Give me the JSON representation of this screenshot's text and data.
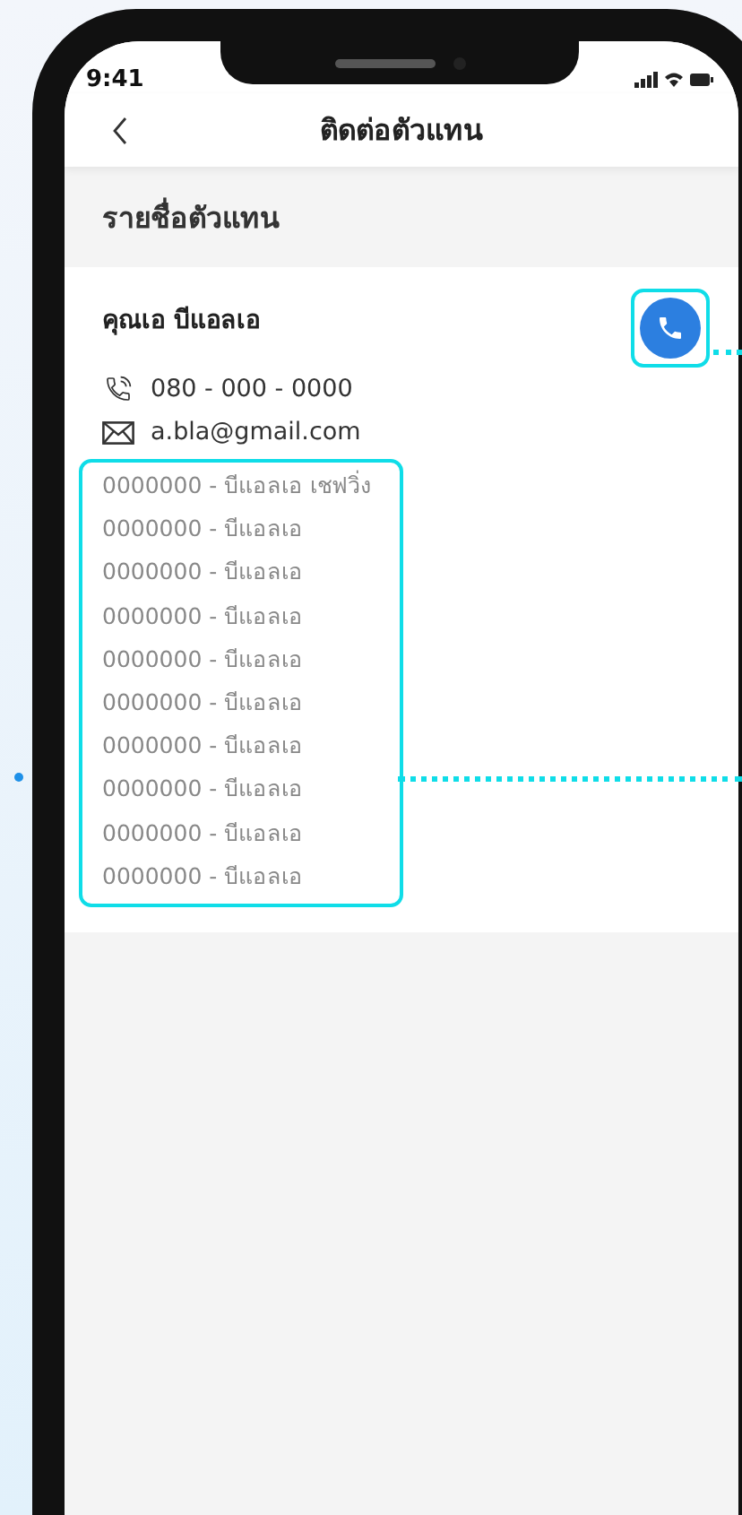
{
  "status_bar": {
    "time": "9:41"
  },
  "header": {
    "title": "ติดต่อตัวแทน"
  },
  "section": {
    "title": "รายชื่อตัวแทน"
  },
  "agent": {
    "name": "คุณเอ บีแอลเอ",
    "phone": "080 - 000 - 0000",
    "email": "a.bla@gmail.com",
    "branches": [
      "0000000 - บีแอลเอ เชฟวิ่ง",
      "0000000 - บีแอลเอ",
      "0000000 - บีแอลเอ",
      "0000000 - บีแอลเอ",
      "0000000 - บีแอลเอ",
      "0000000 - บีแอลเอ",
      "0000000 - บีแอลเอ",
      "0000000 - บีแอลเอ",
      "0000000 - บีแอลเอ",
      "0000000 - บีแอลเอ"
    ]
  }
}
